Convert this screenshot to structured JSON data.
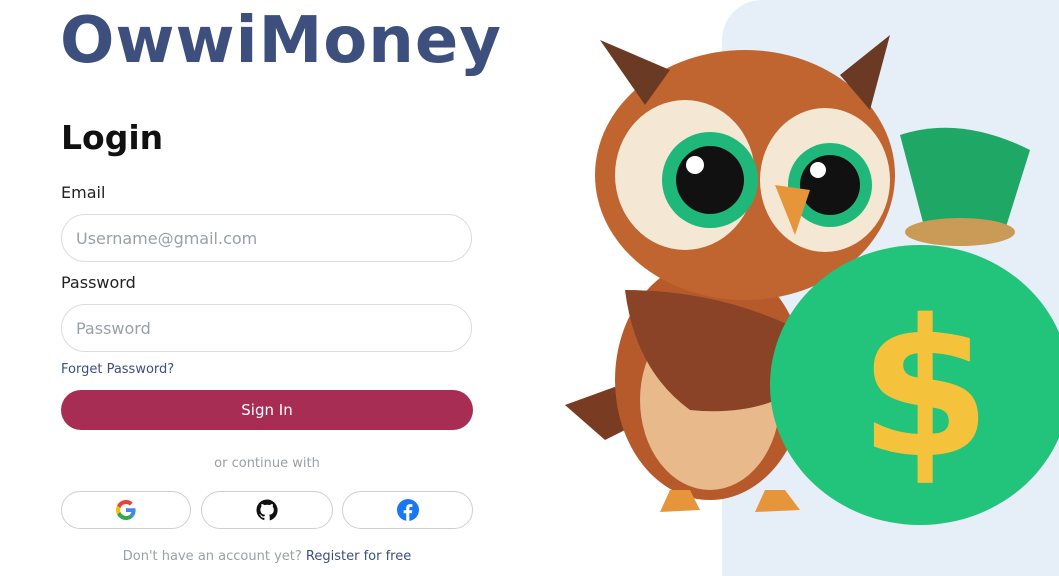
{
  "brand": {
    "name": "OwwiMoney"
  },
  "login": {
    "title": "Login",
    "email_label": "Email",
    "email_placeholder": "Username@gmail.com",
    "password_label": "Password",
    "password_placeholder": "Password",
    "forgot": "Forget Password?",
    "signin": "Sign In",
    "divider": "or continue with",
    "social": [
      "google-icon",
      "github-icon",
      "facebook-icon"
    ],
    "footer_text": "Don't have an account yet?",
    "footer_link": "Register for free"
  },
  "colors": {
    "brand": "#3d4f7c",
    "accent": "#a82d55",
    "panel": "#e6eef7",
    "bag": "#22c37a",
    "dollar": "#f5c33b"
  }
}
